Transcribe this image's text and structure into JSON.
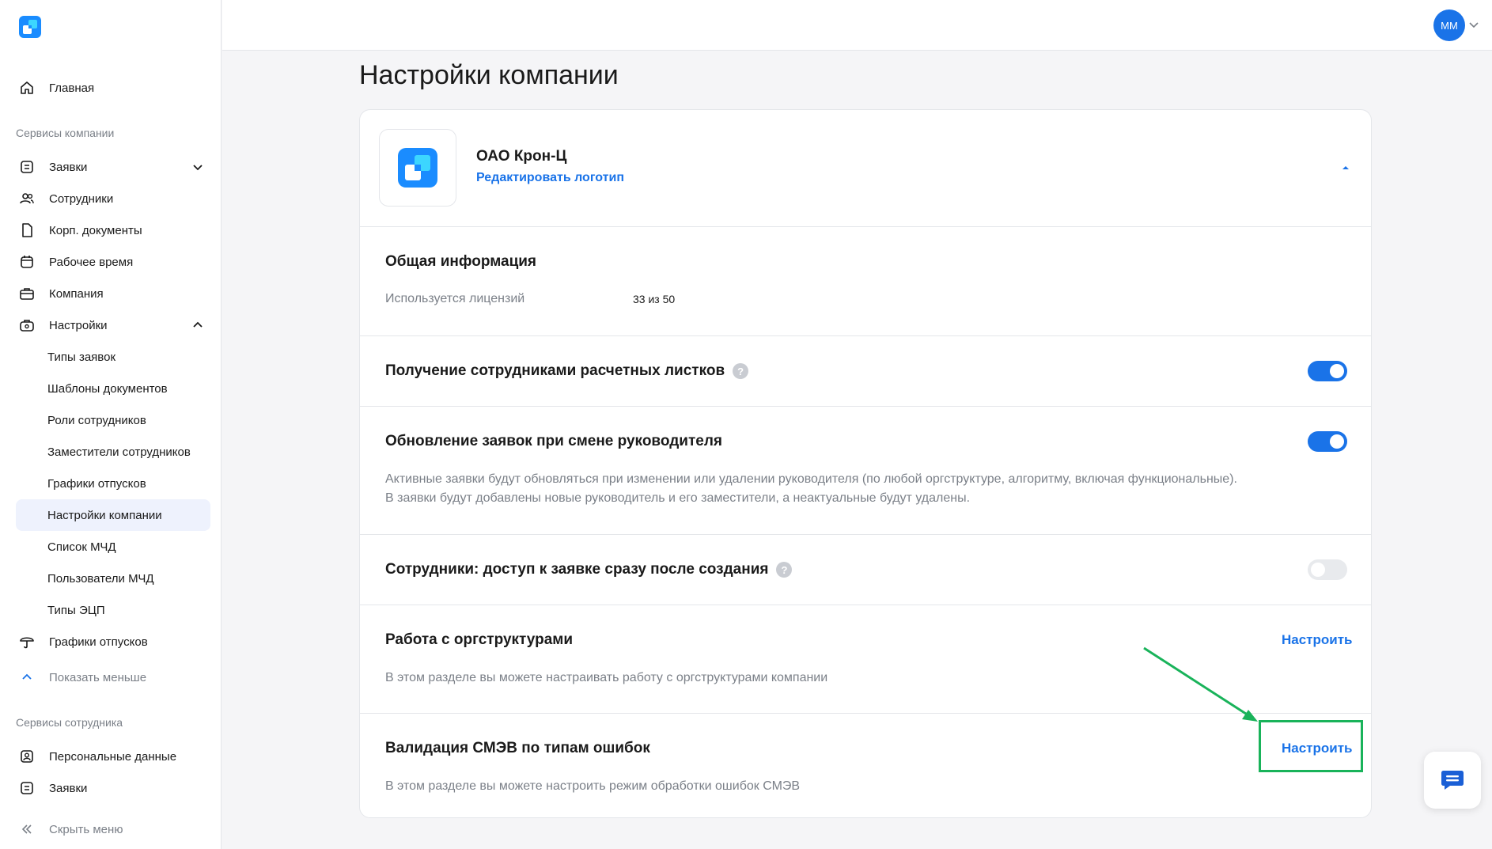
{
  "sidebar": {
    "home": "Главная",
    "company_services_title": "Сервисы компании",
    "company_items": [
      "Заявки",
      "Сотрудники",
      "Корп. документы",
      "Рабочее время",
      "Компания",
      "Настройки"
    ],
    "settings_subitems": [
      "Типы заявок",
      "Шаблоны документов",
      "Роли сотрудников",
      "Заместители сотрудников",
      "Графики отпусков",
      "Настройки компании",
      "Список МЧД",
      "Пользователи МЧД",
      "Типы ЭЦП"
    ],
    "vacation_schedules": "Графики отпусков",
    "show_less": "Показать меньше",
    "employee_services_title": "Сервисы сотрудника",
    "employee_items": [
      "Персональные данные",
      "Заявки"
    ],
    "hide_menu": "Скрыть меню",
    "active_item": "Настройки компании"
  },
  "topbar": {
    "avatar_initials": "ММ"
  },
  "page": {
    "title": "Настройки компании"
  },
  "company": {
    "name": "ОАО Крон-Ц",
    "edit_logo": "Редактировать логотип"
  },
  "general": {
    "title": "Общая информация",
    "licenses_label": "Используется лицензий",
    "licenses_value": "33 из 50"
  },
  "settings": [
    {
      "title": "Получение сотрудниками расчетных листков",
      "help": "?",
      "enabled": true
    },
    {
      "title": "Обновление заявок при смене руководителя",
      "enabled": true,
      "desc1": "Активные заявки будут обновляться при изменении или удалении руководителя (по любой оргструктуре, алгоритму, включая функциональные).",
      "desc2": "В заявки будут добавлены новые руководитель и его заместители, а неактуальные будут удалены."
    },
    {
      "title": "Сотрудники: доступ к заявке сразу после создания",
      "help": "?",
      "enabled": false
    },
    {
      "title": "Работа с оргструктурами",
      "action": "Настроить",
      "desc": "В этом разделе вы можете настраивать работу с оргструктурами компании"
    },
    {
      "title": "Валидация СМЭВ по типам ошибок",
      "action": "Настроить",
      "desc": "В этом разделе вы можете настроить режим обработки ошибок СМЭВ"
    }
  ],
  "colors": {
    "accent": "#1a73e8",
    "annotation": "#19b35a",
    "active_bg": "#eef2fd"
  },
  "icons": [
    "app-logo-icon",
    "home-icon",
    "list-icon",
    "people-icon",
    "document-icon",
    "calendar-icon",
    "briefcase-icon",
    "settings-bag-icon",
    "umbrella-icon",
    "chevron-up-icon",
    "user-card-icon",
    "double-chevron-left-icon",
    "chat-icon"
  ]
}
